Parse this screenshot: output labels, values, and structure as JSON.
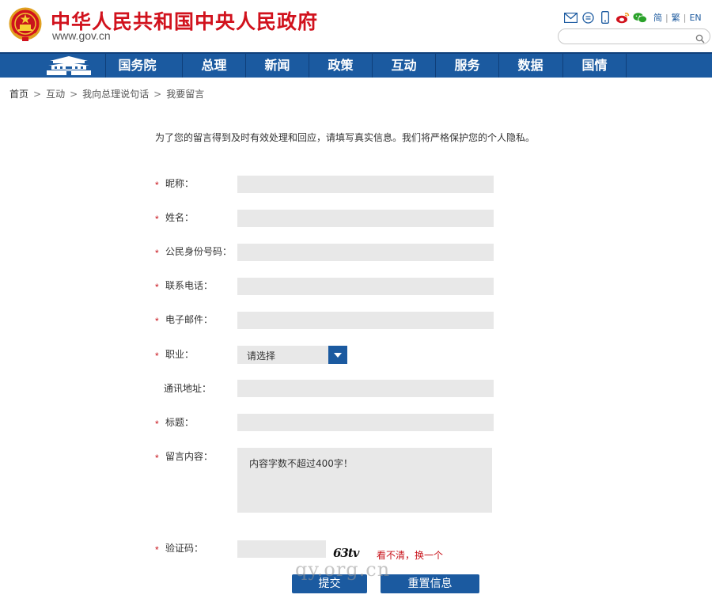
{
  "header": {
    "title": "中华人民共和国中央人民政府",
    "url_prefix": "www.",
    "url_domain": "gov",
    "url_suffix": ".cn",
    "emblem_icon": "national-emblem-icon",
    "tools": [
      "mail-icon",
      "message-icon",
      "mobile-icon",
      "weibo-icon",
      "wechat-icon"
    ],
    "lang": {
      "simplified": "简",
      "traditional": "繁",
      "english": "EN",
      "sep": "|"
    },
    "search_placeholder": ""
  },
  "nav": {
    "home_icon": "tiananmen-icon",
    "items": [
      {
        "label": "国务院"
      },
      {
        "label": "总理"
      },
      {
        "label": "新闻"
      },
      {
        "label": "政策"
      },
      {
        "label": "互动"
      },
      {
        "label": "服务"
      },
      {
        "label": "数据"
      },
      {
        "label": "国情"
      }
    ]
  },
  "breadcrumb": {
    "items": [
      "首页",
      "互动",
      "我向总理说句话",
      "我要留言"
    ],
    "separator": ">"
  },
  "notice": "为了您的留言得到及时有效处理和回应，请填写真实信息。我们将严格保护您的个人隐私。",
  "form": {
    "required_mark": "*",
    "nickname_label": "昵称：",
    "name_label": "姓名：",
    "id_label": "公民身份号码：",
    "phone_label": "联系电话：",
    "email_label": "电子邮件：",
    "job_label": "职业：",
    "job_selected": "请选择",
    "address_label": "通讯地址：",
    "subject_label": "标题：",
    "content_label": "留言内容：",
    "content_placeholder": "内容字数不超过400字！",
    "captcha_label": "验证码：",
    "captcha_text": "63tv",
    "captcha_refresh": "看不清，换一个",
    "submit_label": "提交",
    "reset_label": "重置信息"
  },
  "watermark": "qy.org.cn",
  "colors": {
    "brand_red": "#d1121d",
    "nav_blue": "#1b5aa0",
    "field_gray": "#e8e8e8"
  }
}
